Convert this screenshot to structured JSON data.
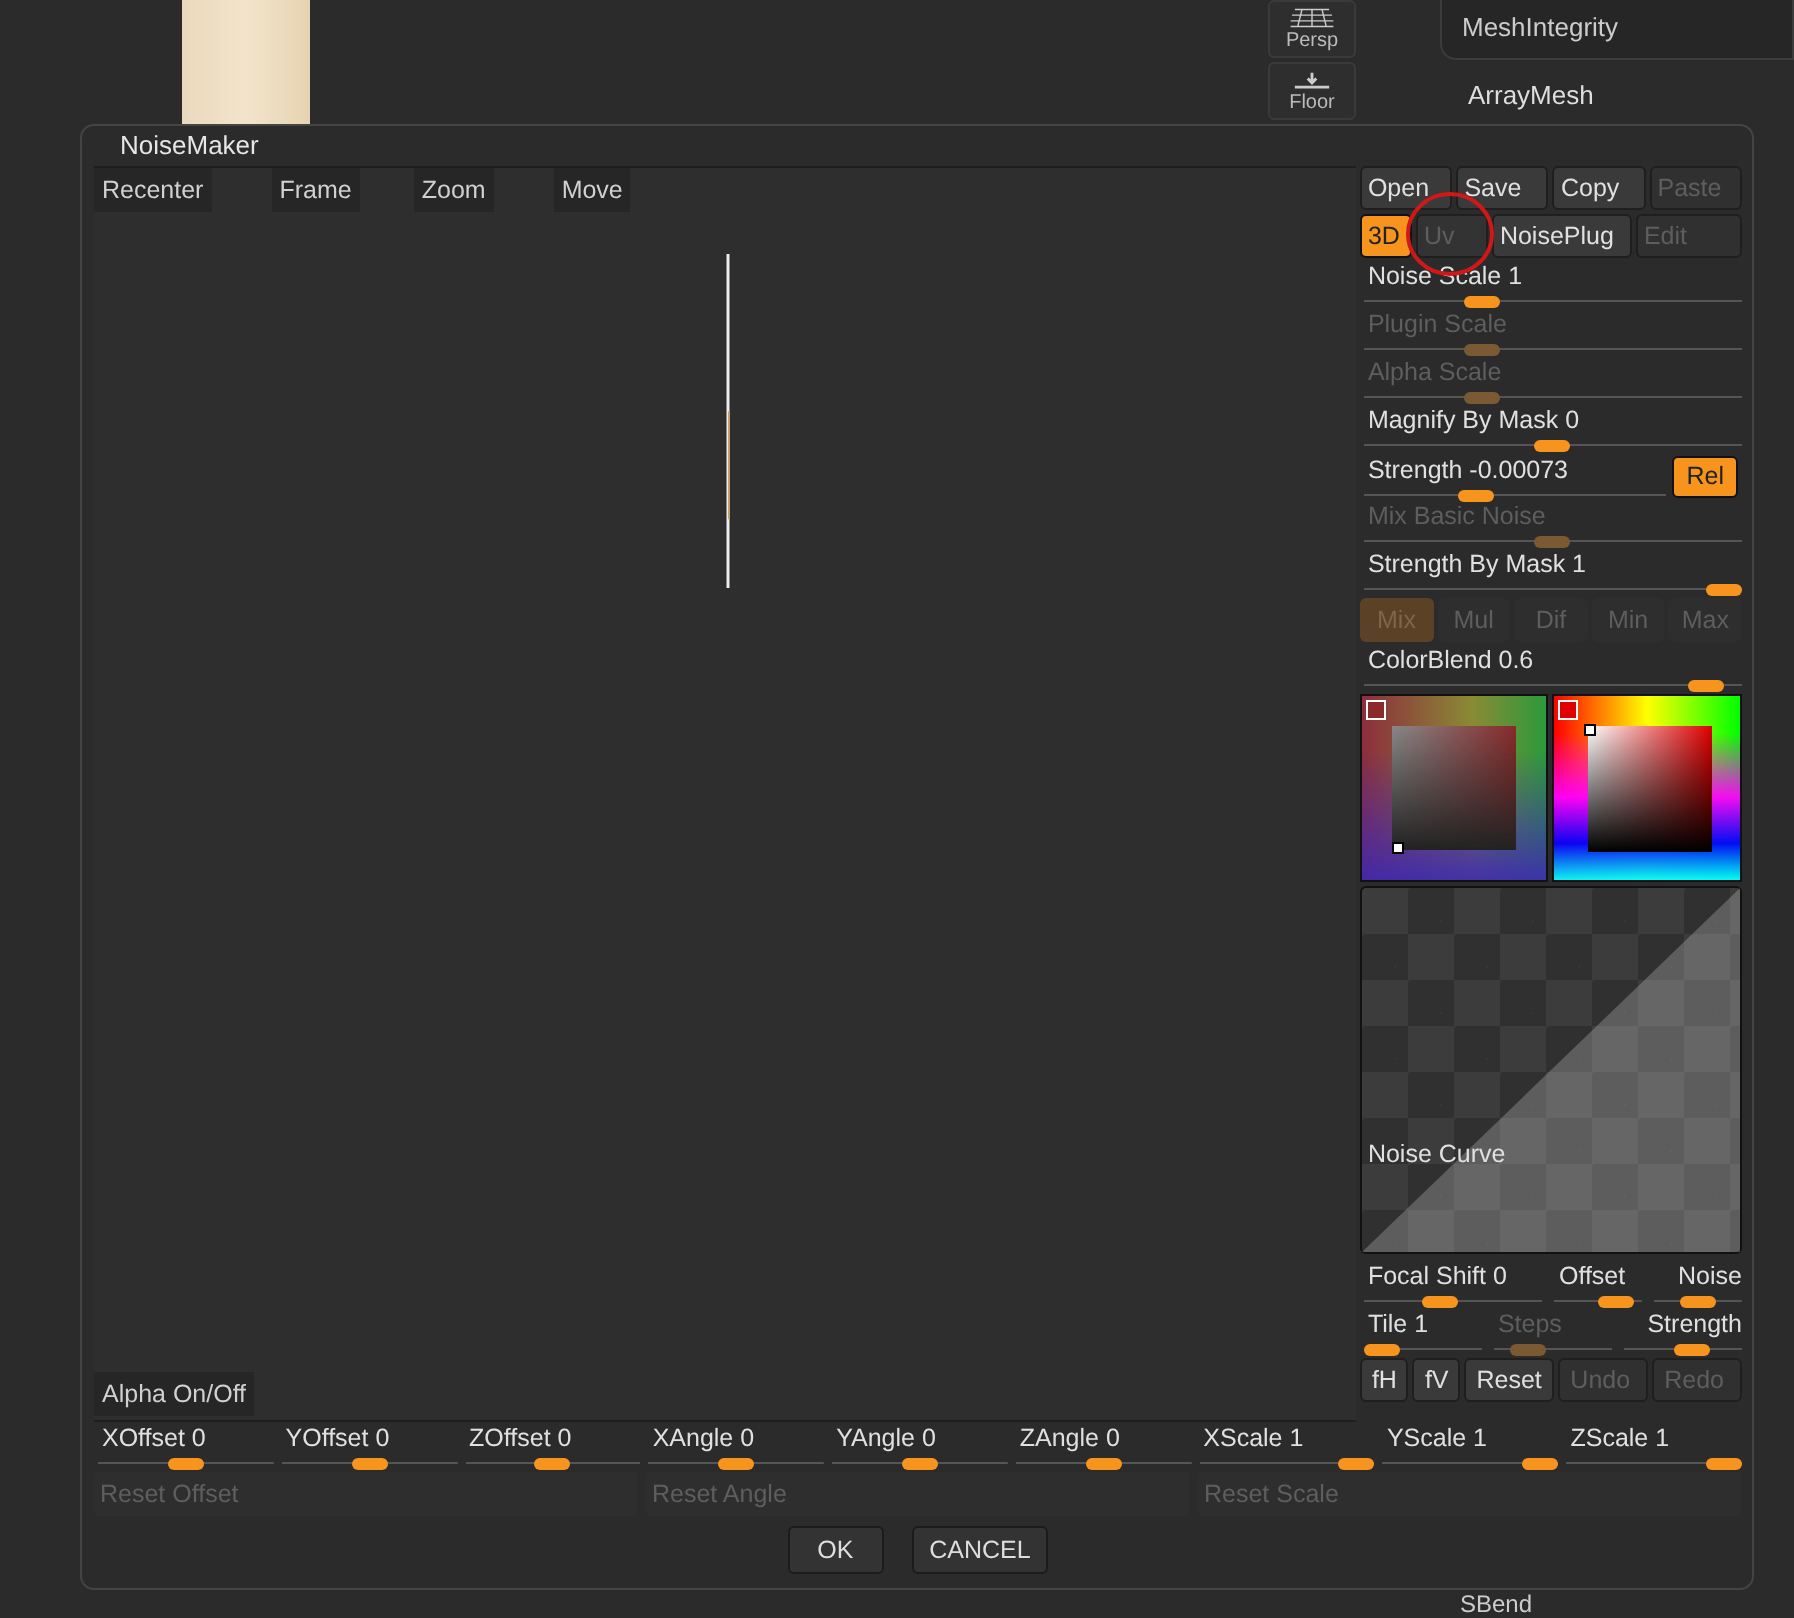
{
  "background": {
    "view_buttons": [
      {
        "label": "Persp",
        "kind": "grid"
      },
      {
        "label": "Floor",
        "kind": "floor"
      }
    ],
    "menu_items": [
      "MeshIntegrity"
    ],
    "section_title": "ArrayMesh",
    "bottom_item": "SBend"
  },
  "window": {
    "title": "NoiseMaker"
  },
  "viewport": {
    "toolbar": [
      "Recenter",
      "Frame",
      "Zoom",
      "Move"
    ],
    "alpha_button": "Alpha On/Off"
  },
  "panel": {
    "file_buttons": [
      {
        "label": "Open",
        "disabled": false
      },
      {
        "label": "Save",
        "disabled": false
      },
      {
        "label": "Copy",
        "disabled": false
      },
      {
        "label": "Paste",
        "disabled": true
      }
    ],
    "mode_buttons": [
      {
        "label": "3D",
        "selected": true,
        "disabled": false
      },
      {
        "label": "Uv",
        "selected": false,
        "disabled": true
      },
      {
        "label": "NoisePlug",
        "selected": false,
        "disabled": false
      },
      {
        "label": "Edit",
        "selected": false,
        "disabled": true
      }
    ],
    "sliders": [
      {
        "label": "Noise Scale",
        "value": "1",
        "level": 0.29,
        "disabled": false
      },
      {
        "label": "Plugin Scale",
        "level": 0.29,
        "disabled": true
      },
      {
        "label": "Alpha Scale",
        "level": 0.29,
        "disabled": true
      },
      {
        "label": "Magnify By Mask",
        "value": "0",
        "level": 0.5,
        "disabled": false
      },
      {
        "label": "Strength",
        "value": "-0.00073",
        "level": 0.35,
        "disabled": false,
        "toggle": {
          "label": "Rel",
          "on": true
        }
      },
      {
        "label": "Mix Basic Noise",
        "level": 0.5,
        "disabled": true
      },
      {
        "label": "Strength By Mask",
        "value": "1",
        "level": 1,
        "disabled": false
      }
    ],
    "blend_modes": [
      {
        "label": "Mix",
        "selected": true,
        "disabled": true
      },
      {
        "label": "Mul",
        "selected": false,
        "disabled": true
      },
      {
        "label": "Dif",
        "selected": false,
        "disabled": true
      },
      {
        "label": "Min",
        "selected": false,
        "disabled": true
      },
      {
        "label": "Max",
        "selected": false,
        "disabled": true
      }
    ],
    "color_blend": {
      "label": "ColorBlend",
      "value": "0.6",
      "level": 0.95,
      "disabled": false
    },
    "curve": {
      "label": "Noise Curve"
    },
    "curve_sliders": [
      [
        {
          "label": "Focal Shift",
          "value": "0",
          "level": 0.4,
          "disabled": false
        },
        {
          "label": "Offset",
          "level": 0.85,
          "disabled": false
        },
        {
          "label": "Noise",
          "level": 0.5,
          "disabled": false
        }
      ],
      [
        {
          "label": "Tile",
          "value": "1",
          "level": 0,
          "disabled": false
        },
        {
          "label": "Steps",
          "level": 0.2,
          "disabled": true
        },
        {
          "label": "Strength",
          "level": 0.6,
          "disabled": false
        }
      ]
    ],
    "curve_buttons": [
      {
        "label": "fH",
        "disabled": false
      },
      {
        "label": "fV",
        "disabled": false
      },
      {
        "label": "Reset",
        "disabled": false
      },
      {
        "label": "Undo",
        "disabled": true
      },
      {
        "label": "Redo",
        "disabled": true
      }
    ]
  },
  "transform_sliders": [
    {
      "label": "XOffset",
      "value": "0",
      "level": 0.5
    },
    {
      "label": "YOffset",
      "value": "0",
      "level": 0.5
    },
    {
      "label": "ZOffset",
      "value": "0",
      "level": 0.5
    },
    {
      "label": "XAngle",
      "value": "0",
      "level": 0.5
    },
    {
      "label": "YAngle",
      "value": "0",
      "level": 0.5
    },
    {
      "label": "ZAngle",
      "value": "0",
      "level": 0.5
    },
    {
      "label": "XScale",
      "value": "1",
      "level": 1
    },
    {
      "label": "YScale",
      "value": "1",
      "level": 1
    },
    {
      "label": "ZScale",
      "value": "1",
      "level": 1
    }
  ],
  "reset_buttons": [
    {
      "label": "Reset Offset",
      "disabled": true
    },
    {
      "label": "Reset Angle",
      "disabled": true
    },
    {
      "label": "Reset Scale",
      "disabled": true
    }
  ],
  "dialog_buttons": [
    "OK",
    "CANCEL"
  ]
}
